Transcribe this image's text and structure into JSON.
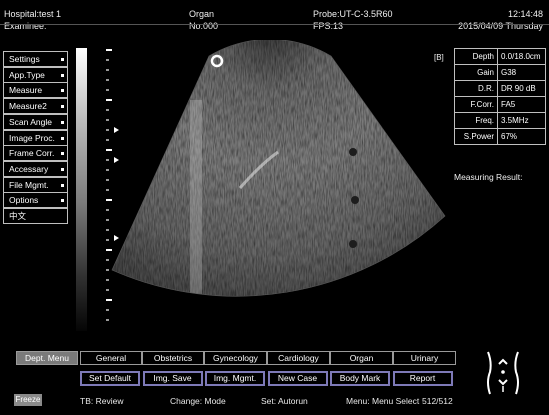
{
  "header": {
    "hospital": "Hospital:test 1",
    "examinee": "Examinee:",
    "preset": "Organ",
    "number": "No:000",
    "probe": "Probe:UT-C-3.5R60",
    "fps": "FPS:13",
    "time": "12:14:48",
    "date": "2015/04/09 Thursday"
  },
  "left_menu": [
    {
      "label": "Settings"
    },
    {
      "label": "App.Type"
    },
    {
      "label": "Measure"
    },
    {
      "label": "Measure2"
    },
    {
      "label": "Scan Angle"
    },
    {
      "label": "Image Proc."
    },
    {
      "label": "Frame Corr."
    },
    {
      "label": "Accessary"
    },
    {
      "label": "File Mgmt."
    },
    {
      "label": "Options"
    },
    {
      "label": "中文"
    }
  ],
  "image": {
    "marker_label": "[B]"
  },
  "params": [
    {
      "key": "Depth",
      "value": "0.0/18.0cm"
    },
    {
      "key": "Gain",
      "value": "G38"
    },
    {
      "key": "D.R.",
      "value": "DR 90 dB"
    },
    {
      "key": "F.Corr.",
      "value": "FA5"
    },
    {
      "key": "Freq.",
      "value": "3.5MHz"
    },
    {
      "key": "S.Power",
      "value": "67%"
    }
  ],
  "measuring_result_label": "Measuring Result:",
  "dept_tabs": [
    {
      "label": "Dept. Menu"
    },
    {
      "label": "General"
    },
    {
      "label": "Obstetrics"
    },
    {
      "label": "Gynecology"
    },
    {
      "label": "Cardiology"
    },
    {
      "label": "Organ"
    },
    {
      "label": "Urinary"
    }
  ],
  "action_buttons": [
    {
      "label": "Set Default"
    },
    {
      "label": "Img. Save"
    },
    {
      "label": "Img. Mgmt."
    },
    {
      "label": "New Case"
    },
    {
      "label": "Body Mark"
    },
    {
      "label": "Report"
    }
  ],
  "status_bar": {
    "freeze": "Freeze",
    "tb": "TB: Review",
    "change": "Change: Mode",
    "set": "Set: Autorun",
    "menu": "Menu: Menu Select",
    "frames": "512/512"
  },
  "colors": {
    "button_border": "#7e7ab8",
    "tab_active": "#7a7a7a",
    "frame": "#bfbfbf"
  }
}
